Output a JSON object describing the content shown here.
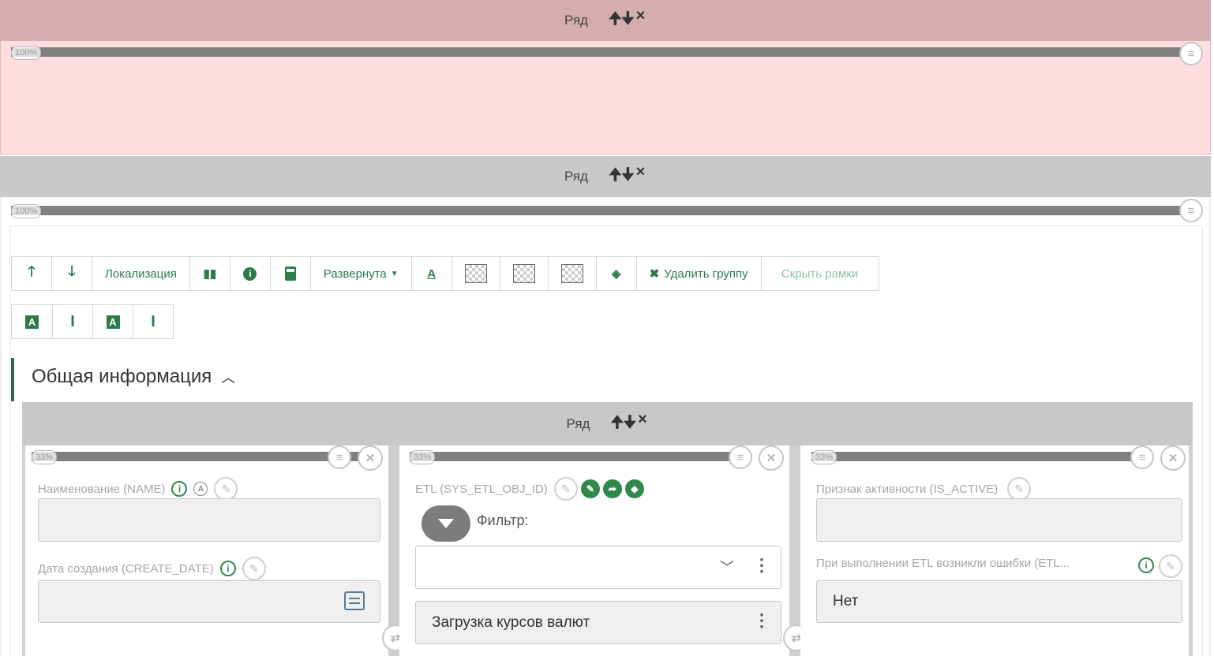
{
  "row_label": "Ряд",
  "row_controls": {
    "up": "🠉",
    "down": "🠋",
    "remove": "×"
  },
  "row1": {
    "width_label": "100%"
  },
  "row2": {
    "width_label": "100%"
  },
  "toolbar": {
    "localization": "Локализация",
    "expanded": "Развернута",
    "delete_group": "Удалить группу",
    "hide_frames": "Скрыть рамки"
  },
  "section": {
    "title": "Общая информация"
  },
  "inner_row": {
    "label": "Ряд"
  },
  "columns": [
    {
      "width_label": "33%"
    },
    {
      "width_label": "33%"
    },
    {
      "width_label": "33%"
    }
  ],
  "col1": {
    "name_label": "Наименование (NAME)",
    "name_value": "",
    "date_label": "Дата создания (CREATE_DATE)",
    "date_value": ""
  },
  "col2": {
    "etl_label": "ETL (SYS_ETL_OBJ_ID)",
    "filter_label": "Фильтр:",
    "filter_value": "",
    "selected_value": "Загрузка курсов валют"
  },
  "col3": {
    "active_label": "Признак активности (IS_ACTIVE)",
    "active_value": "",
    "errors_label": "При выполнении ETL возникли ошибки (ETL...",
    "errors_value": "Нет"
  },
  "colors": {
    "accent": "#2d7a4a",
    "row1_bg": "#fddde0",
    "row1_header": "#d4adb0",
    "row_header": "#c8c8c8"
  }
}
